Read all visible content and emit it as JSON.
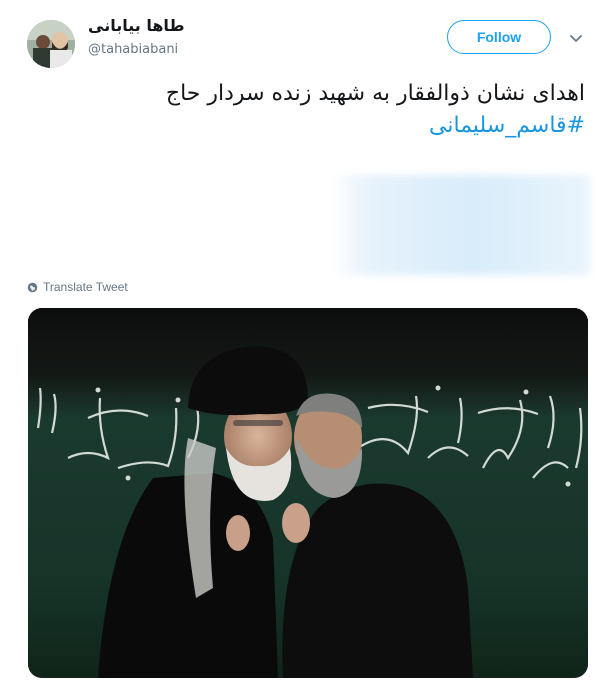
{
  "user": {
    "display_name": "طاها بیابانی",
    "handle": "@tahabiabani"
  },
  "actions": {
    "follow_label": "Follow"
  },
  "tweet": {
    "text": "اهدای نشان ذوالفقار به شهید زنده سردار حاج",
    "hashtag": "#قاسم_سلیمانی"
  },
  "translate": {
    "label": "Translate Tweet"
  },
  "media": {
    "banner_text": "السلام علی الحسین و علی علی بن الحسین و علی اولاد الحسین"
  },
  "colors": {
    "accent": "#1da1f2",
    "hashtag": "#1b95e0",
    "muted": "#657786"
  },
  "icons": {
    "menu": "chevron-down-icon",
    "translate": "globe-icon"
  }
}
